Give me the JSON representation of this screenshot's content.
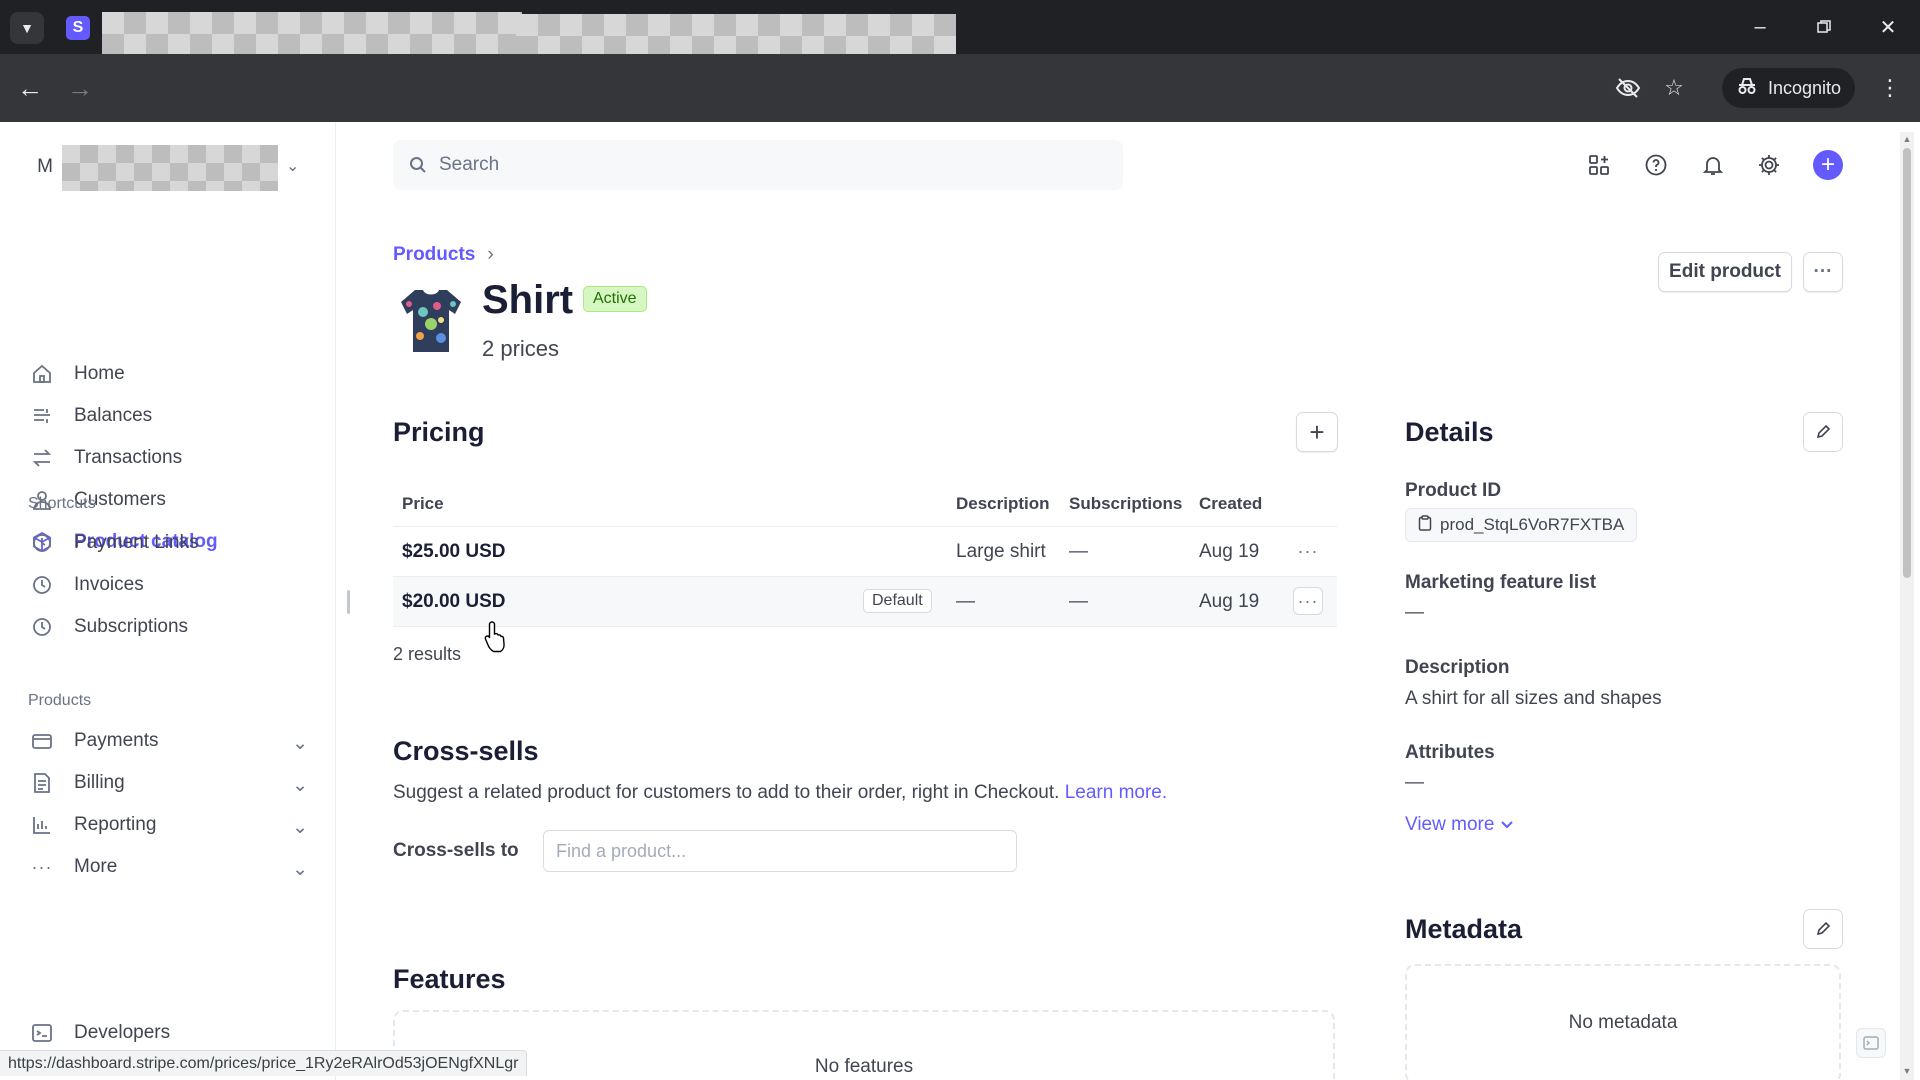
{
  "browser": {
    "incognito_label": "Incognito",
    "status_url": "https://dashboard.stripe.com/prices/price_1Ry2eRAlrOd53jOENgfXNLgr",
    "favicon_letter": "S"
  },
  "account": {
    "initial": "M"
  },
  "search": {
    "placeholder": "Search"
  },
  "sidebar": {
    "items": [
      {
        "label": "Home",
        "icon": "home-icon"
      },
      {
        "label": "Balances",
        "icon": "balances-icon"
      },
      {
        "label": "Transactions",
        "icon": "transactions-icon"
      },
      {
        "label": "Customers",
        "icon": "customers-icon"
      },
      {
        "label": "Product catalog",
        "icon": "product-catalog-icon",
        "active": true
      }
    ],
    "shortcuts_title": "Shortcuts",
    "shortcuts": [
      {
        "label": "Payment Links",
        "icon": "clock-icon"
      },
      {
        "label": "Invoices",
        "icon": "clock-icon"
      },
      {
        "label": "Subscriptions",
        "icon": "clock-icon"
      }
    ],
    "products_title": "Products",
    "products": [
      {
        "label": "Payments",
        "icon": "payments-icon"
      },
      {
        "label": "Billing",
        "icon": "billing-icon"
      },
      {
        "label": "Reporting",
        "icon": "reporting-icon"
      },
      {
        "label": "More",
        "icon": "more-icon"
      }
    ],
    "developers": {
      "label": "Developers",
      "icon": "developers-icon"
    }
  },
  "breadcrumb": {
    "root": "Products"
  },
  "product": {
    "name": "Shirt",
    "status": "Active",
    "prices_count": "2 prices",
    "edit_label": "Edit product"
  },
  "pricing": {
    "title": "Pricing",
    "columns": [
      "Price",
      "Description",
      "Subscriptions",
      "Created"
    ],
    "rows": [
      {
        "price": "$25.00 USD",
        "default": "",
        "description": "Large shirt",
        "subscriptions": "—",
        "created": "Aug 19"
      },
      {
        "price": "$20.00 USD",
        "default": "Default",
        "description": "—",
        "subscriptions": "—",
        "created": "Aug 19"
      }
    ],
    "results": "2 results"
  },
  "cross_sells": {
    "title": "Cross-sells",
    "description": "Suggest a related product for customers to add to their order, right in Checkout.",
    "learn_more": "Learn more.",
    "label": "Cross-sells to",
    "placeholder": "Find a product..."
  },
  "features": {
    "title": "Features",
    "empty": "No features"
  },
  "details": {
    "title": "Details",
    "product_id_label": "Product ID",
    "product_id": "prod_StqL6VoR7FXTBA",
    "marketing_label": "Marketing feature list",
    "marketing_value": "—",
    "description_label": "Description",
    "description_value": "A shirt for all sizes and shapes",
    "attributes_label": "Attributes",
    "attributes_value": "—",
    "view_more": "View more"
  },
  "metadata": {
    "title": "Metadata",
    "empty": "No metadata"
  },
  "colors": {
    "accent": "#635bff",
    "active_badge_bg": "#d7f7c2",
    "active_badge_text": "#217005"
  }
}
